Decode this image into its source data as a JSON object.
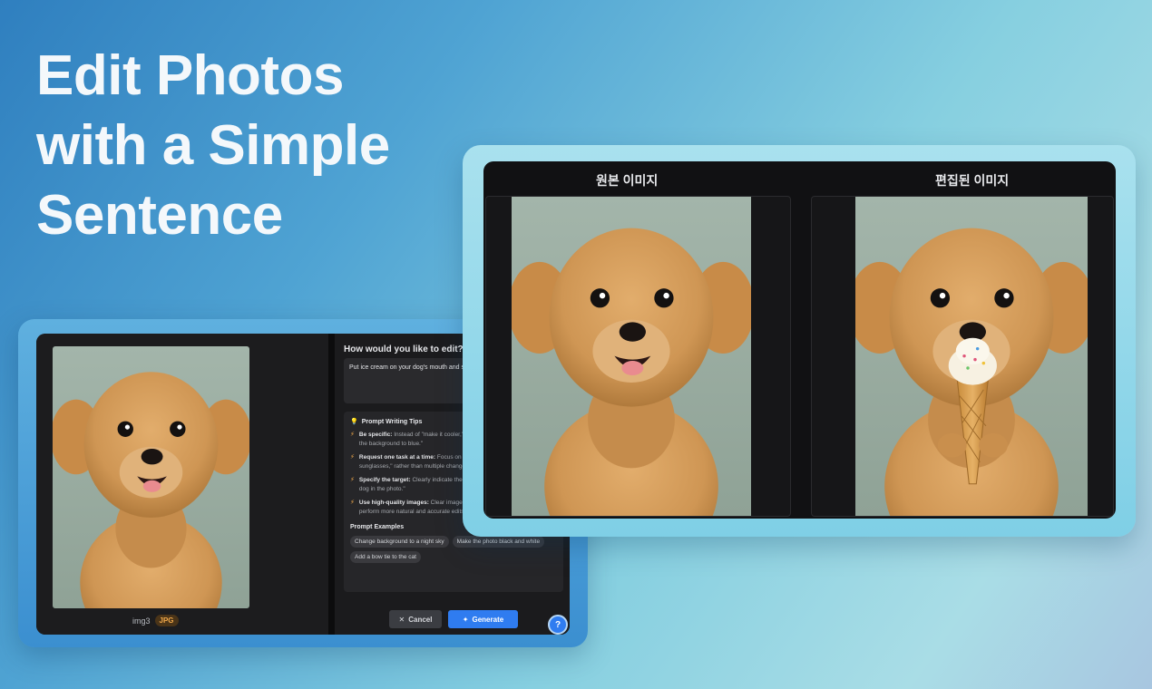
{
  "headline": [
    "Edit Photos",
    "with a Simple",
    "Sentence"
  ],
  "editor": {
    "file_name": "img3",
    "file_type": "JPG",
    "question": "How would you like to edit?",
    "prompt_value": "Put ice cream on your dog's mouth and sunglass",
    "tips_title": "Prompt Writing Tips",
    "tips": [
      {
        "bold": "Be specific:",
        "text": " Instead of \"make it cooler,\" requ",
        "line2": "the background to blue.\""
      },
      {
        "bold": "Request one task at a time:",
        "text": " Focus on a singl",
        "line2": "sunglasses,\" rather than multiple changes at"
      },
      {
        "bold": "Specify the target:",
        "text": " Clearly indicate the subje",
        "line2": "dog in the photo.\""
      },
      {
        "bold": "Use high-quality images:",
        "text": " Clear images with",
        "line2": "perform more natural and accurate edits."
      }
    ],
    "examples_title": "Prompt Examples",
    "examples": [
      "Change background to a night sky",
      "Make the photo black and white",
      "Add a bow tie to the cat"
    ],
    "cancel_label": "Cancel",
    "generate_label": "Generate"
  },
  "compare": {
    "original_title": "원본 이미지",
    "edited_title": "편집된 이미지"
  },
  "colors": {
    "accent": "#2f7cf0",
    "jpg_badge": "#f0a84a",
    "backdrop": "#9aada0",
    "fur": "#cf9654"
  }
}
